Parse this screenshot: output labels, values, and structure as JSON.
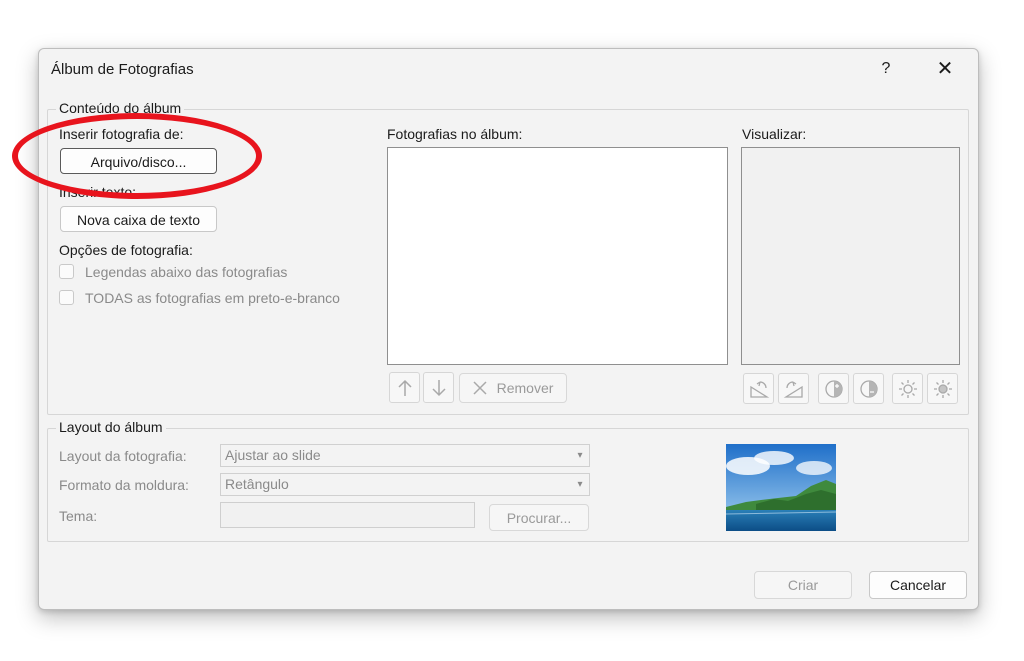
{
  "dialog": {
    "title": "Álbum de Fotografias",
    "help_label": "?",
    "close_label": "✕"
  },
  "album_content": {
    "legend": "Conteúdo do álbum",
    "insert_photo_from": "Inserir fotografia de:",
    "file_disk_button": "Arquivo/disco...",
    "insert_text": "Inserir texto:",
    "new_text_box_button": "Nova caixa de texto",
    "photo_options": "Opções de fotografia:",
    "captions_below_label": "Legendas abaixo das fotografias",
    "all_black_white_label": "TODAS as fotografias em preto-e-branco",
    "captions_below_checked": false,
    "all_black_white_checked": false,
    "photos_in_album": "Fotografias no álbum:",
    "preview": "Visualizar:",
    "remove_button": "Remover"
  },
  "album_layout": {
    "legend": "Layout do álbum",
    "picture_layout_label": "Layout da fotografia:",
    "picture_layout_value": "Ajustar ao slide",
    "frame_shape_label": "Formato da moldura:",
    "frame_shape_value": "Retângulo",
    "theme_label": "Tema:",
    "theme_value": "",
    "browse_button": "Procurar..."
  },
  "footer": {
    "create_button": "Criar",
    "cancel_button": "Cancelar"
  },
  "icons": [
    "help-icon",
    "close-icon",
    "move-up-icon",
    "move-down-icon",
    "remove-x-icon",
    "rotate-left-icon",
    "rotate-right-icon",
    "contrast-increase-icon",
    "contrast-decrease-icon",
    "brightness-increase-icon",
    "brightness-decrease-icon",
    "dropdown-arrow-icon"
  ],
  "colors": {
    "highlight_ellipse": "#e8141d",
    "dialog_bg": "#f3f3f3"
  }
}
